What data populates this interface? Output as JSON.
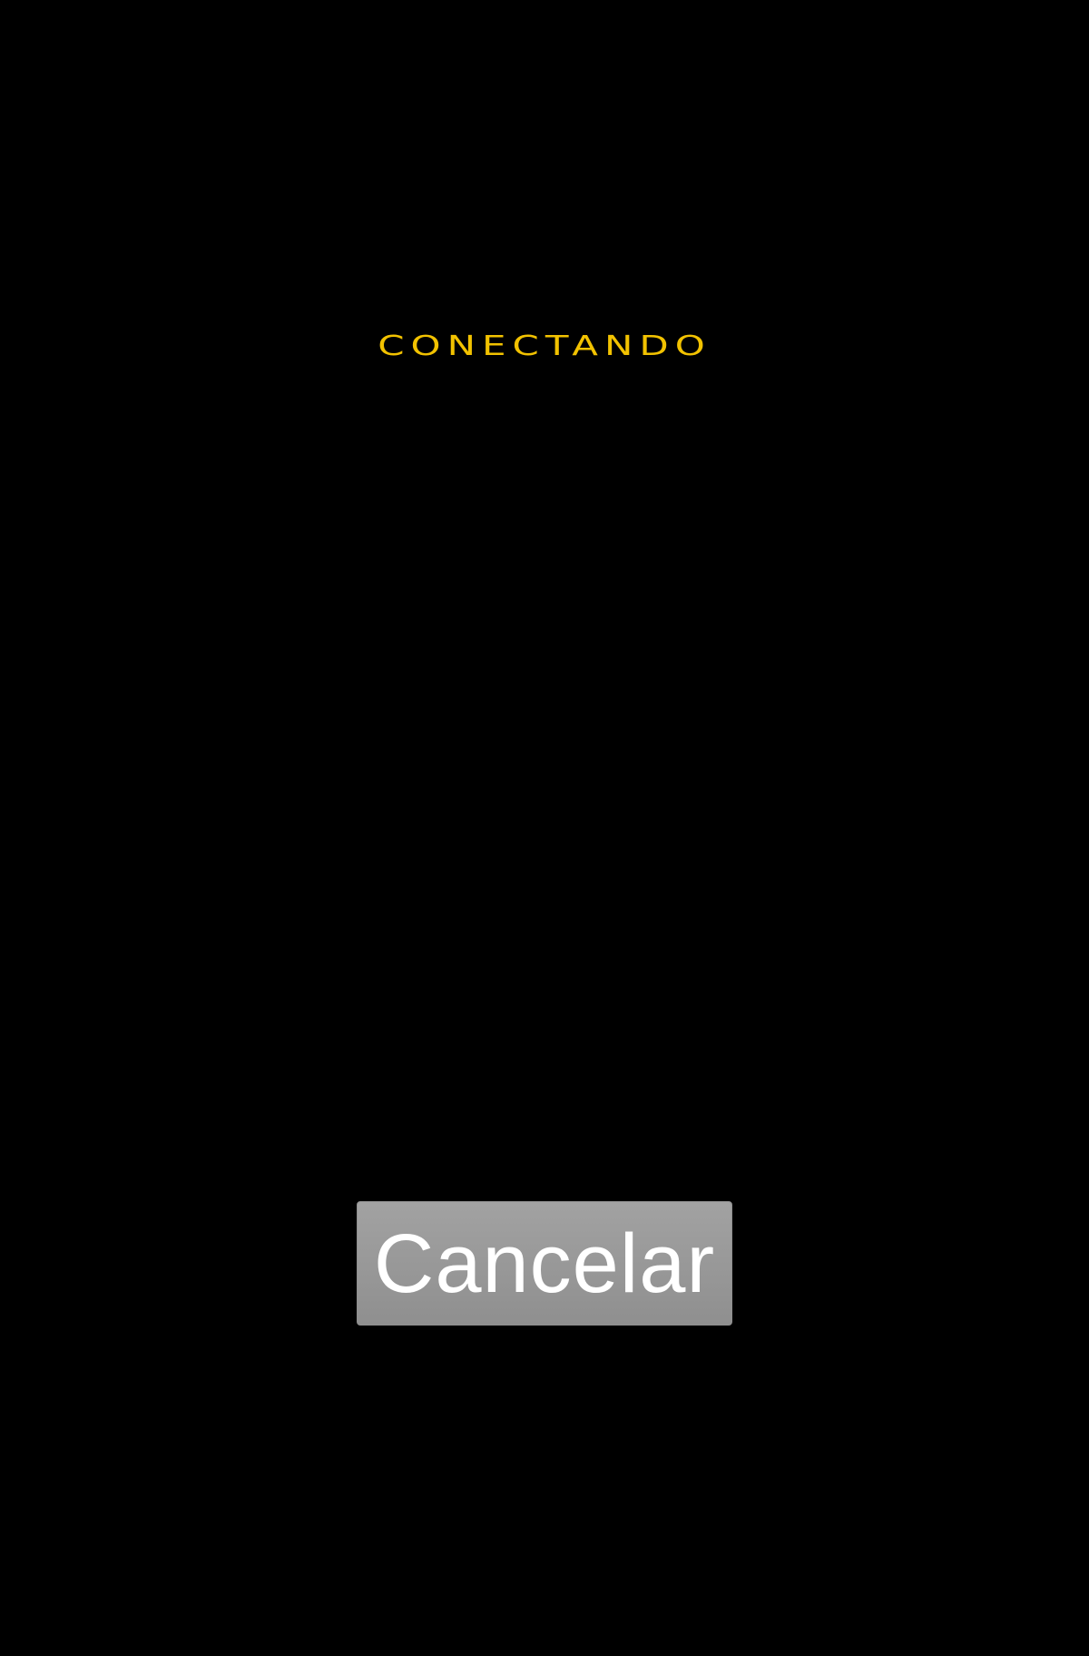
{
  "screen": {
    "status_text": "CONECTANDO",
    "cancel_label": "Cancelar"
  },
  "colors": {
    "background": "#000000",
    "status_text": "#f2c200",
    "button_fill": "#999999",
    "button_text": "#ffffff"
  }
}
